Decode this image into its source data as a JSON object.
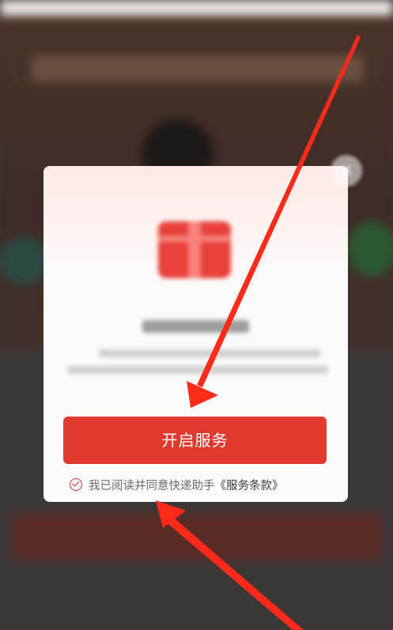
{
  "dialog": {
    "cta_label": "开启服务",
    "agree_text": "我已阅读并同意快递助手",
    "terms_link": "《服务条款》",
    "close_glyph": "×"
  },
  "icons": {
    "gift": "gift-box-icon",
    "close": "close-icon",
    "check": "check-circle-icon"
  },
  "colors": {
    "accent": "#e03a2e",
    "annotation_arrow": "#ff2a1a"
  }
}
